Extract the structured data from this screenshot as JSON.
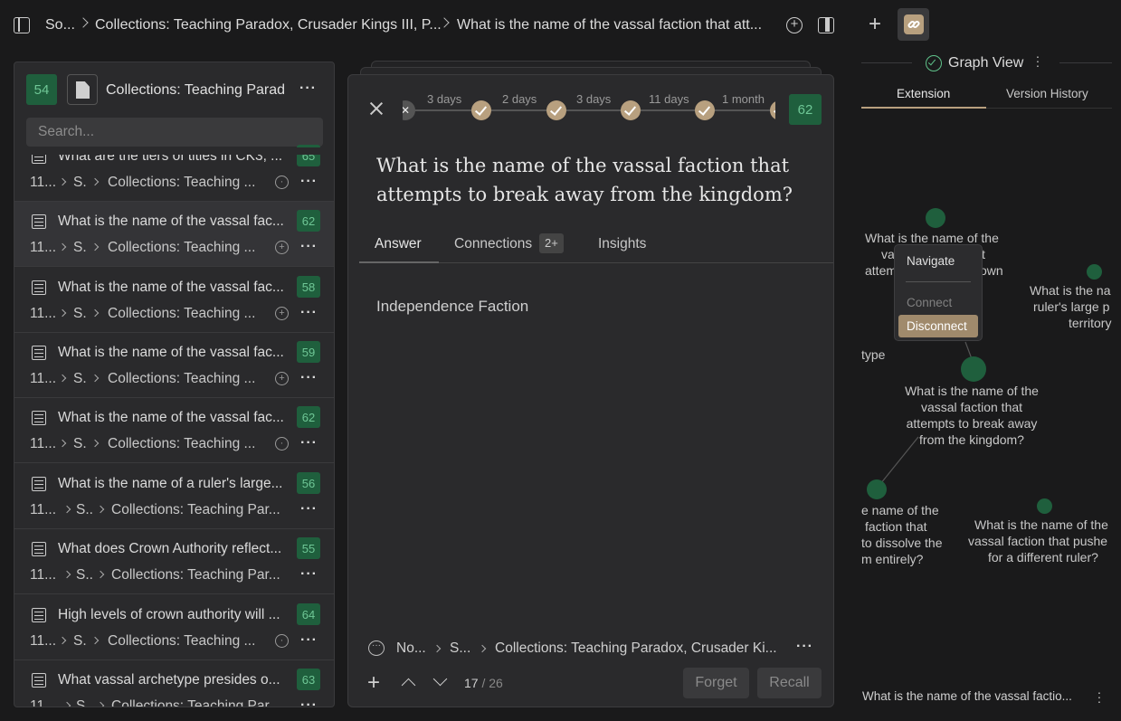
{
  "topbar": {
    "crumb1": "So...",
    "crumb2": "Collections: Teaching Paradox, Crusader Kings III, P...",
    "crumb3": "What is the name of the vassal faction that att..."
  },
  "left": {
    "count": "54",
    "title": "Collections: Teaching Parad",
    "search_placeholder": "Search...",
    "items": [
      {
        "title": "What are the tiers of titles in CK3, ...",
        "badge": "65",
        "m1": "11...",
        "m2": "S.",
        "m3": "Collections: Teaching ...",
        "icon": "comment"
      },
      {
        "title": "What is the name of the vassal fac...",
        "badge": "62",
        "m1": "11...",
        "m2": "S.",
        "m3": "Collections: Teaching ...",
        "icon": "plus"
      },
      {
        "title": "What is the name of the vassal fac...",
        "badge": "58",
        "m1": "11...",
        "m2": "S.",
        "m3": "Collections: Teaching ...",
        "icon": "plus"
      },
      {
        "title": "What is the name of the vassal fac...",
        "badge": "59",
        "m1": "11...",
        "m2": "S.",
        "m3": "Collections: Teaching ...",
        "icon": "plus"
      },
      {
        "title": "What is the name of the vassal fac...",
        "badge": "62",
        "m1": "11...",
        "m2": "S.",
        "m3": "Collections: Teaching ...",
        "icon": "comment"
      },
      {
        "title": "What is the name of a ruler's large...",
        "badge": "56",
        "m1": "11...",
        "m2": "S..",
        "m3": "Collections: Teaching Par...",
        "icon": ""
      },
      {
        "title": "What does Crown Authority reflect...",
        "badge": "55",
        "m1": "11...",
        "m2": "S..",
        "m3": "Collections: Teaching Par...",
        "icon": ""
      },
      {
        "title": "High levels of crown authority will ...",
        "badge": "64",
        "m1": "11...",
        "m2": "S.",
        "m3": "Collections: Teaching ...",
        "icon": "comment"
      },
      {
        "title": "What vassal archetype presides o...",
        "badge": "63",
        "m1": "11...",
        "m2": "S..",
        "m3": "Collections: Teaching Par...",
        "icon": ""
      }
    ]
  },
  "card": {
    "timeline": [
      "3 days",
      "2 days",
      "3 days",
      "11 days",
      "1 month"
    ],
    "score": "62",
    "question_line1": "What is the name of the vassal faction that",
    "question_line2": "attempts to break away from the kingdom?",
    "tab_answer": "Answer",
    "tab_connections": "Connections",
    "connections_badge": "2+",
    "tab_insights": "Insights",
    "answer": "Independence Faction",
    "footer_c1": "No...",
    "footer_c2": "S...",
    "footer_c3": "Collections: Teaching Paradox, Crusader Ki...",
    "position": "17",
    "total": "/ 26",
    "forget": "Forget",
    "recall": "Recall"
  },
  "right": {
    "graph_view": "Graph View",
    "tab_extension": "Extension",
    "tab_version": "Version History",
    "menu_navigate": "Navigate",
    "menu_connect": "Connect",
    "menu_disconnect": "Disconnect",
    "n1_l1": "What is the name of the",
    "n1_l2a": "va",
    "n1_l2b": "t",
    "n1_l3a": "attem",
    "n1_l3b": "own",
    "n2_l1": "What is the na",
    "n2_l2": "ruler's large p",
    "n2_l3": "territory",
    "type_label": "type",
    "center_l1": "What is the name of the",
    "center_l2": "vassal faction that",
    "center_l3": "attempts to break away",
    "center_l4": "from the kingdom?",
    "n4_l1": "e name of the",
    "n4_l2": "faction that",
    "n4_l3": "to dissolve the",
    "n4_l4": "m entirely?",
    "n5_l1": "What is the name of the",
    "n5_l2": "vassal faction that pushe",
    "n5_l3": "for a different ruler?",
    "footer_text": "What is the name of the vassal factio..."
  },
  "colors": {
    "accent_green": "#1f5f3d",
    "accent_tan": "#b8a07f"
  }
}
